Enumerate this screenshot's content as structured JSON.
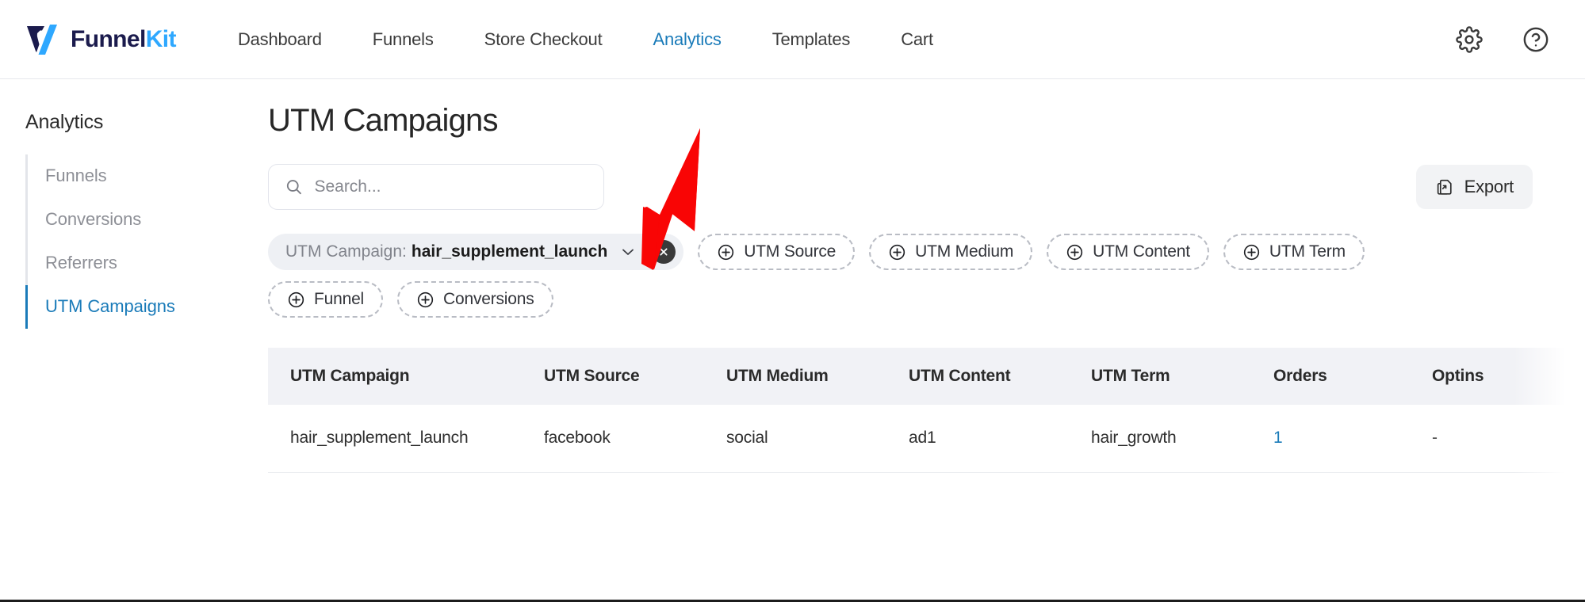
{
  "brand": {
    "name_dark": "Funnel",
    "name_accent": "Kit",
    "logo_icon": "funnelkit-v-logo"
  },
  "topnav": {
    "items": [
      {
        "label": "Dashboard",
        "active": false
      },
      {
        "label": "Funnels",
        "active": false
      },
      {
        "label": "Store Checkout",
        "active": false
      },
      {
        "label": "Analytics",
        "active": true
      },
      {
        "label": "Templates",
        "active": false
      },
      {
        "label": "Cart",
        "active": false
      }
    ],
    "settings_icon": "gear-icon",
    "help_icon": "help-circle-icon"
  },
  "sidebar": {
    "title": "Analytics",
    "items": [
      {
        "label": "Funnels",
        "active": false
      },
      {
        "label": "Conversions",
        "active": false
      },
      {
        "label": "Referrers",
        "active": false
      },
      {
        "label": "UTM Campaigns",
        "active": true
      }
    ]
  },
  "main": {
    "title": "UTM Campaigns",
    "search": {
      "value": "",
      "placeholder": "Search..."
    },
    "export": {
      "label": "Export",
      "icon": "export-document-icon"
    }
  },
  "filters": {
    "active": {
      "label": "UTM Campaign:",
      "value": "hair_supplement_launch",
      "chevron_icon": "chevron-down-icon",
      "remove_icon": "close-circle-icon"
    },
    "available": [
      {
        "label": "UTM Source"
      },
      {
        "label": "UTM Medium"
      },
      {
        "label": "UTM Content"
      },
      {
        "label": "UTM Term"
      },
      {
        "label": "Funnel"
      },
      {
        "label": "Conversions"
      }
    ]
  },
  "table": {
    "columns": [
      "UTM Campaign",
      "UTM Source",
      "UTM Medium",
      "UTM Content",
      "UTM Term",
      "Orders",
      "Optins"
    ],
    "rows": [
      {
        "utm_campaign": "hair_supplement_launch",
        "utm_source": "facebook",
        "utm_medium": "social",
        "utm_content": "ad1",
        "utm_term": "hair_growth",
        "orders": "1",
        "optins": "-"
      }
    ]
  },
  "annotation": {
    "arrow_color": "#f90505",
    "arrow_target": "filter-remove-button"
  },
  "colors": {
    "accent_blue": "#1a7bb9",
    "brand_dark": "#1b1b4d",
    "brand_light": "#2ea8ff",
    "table_header_bg": "#f1f2f6"
  }
}
